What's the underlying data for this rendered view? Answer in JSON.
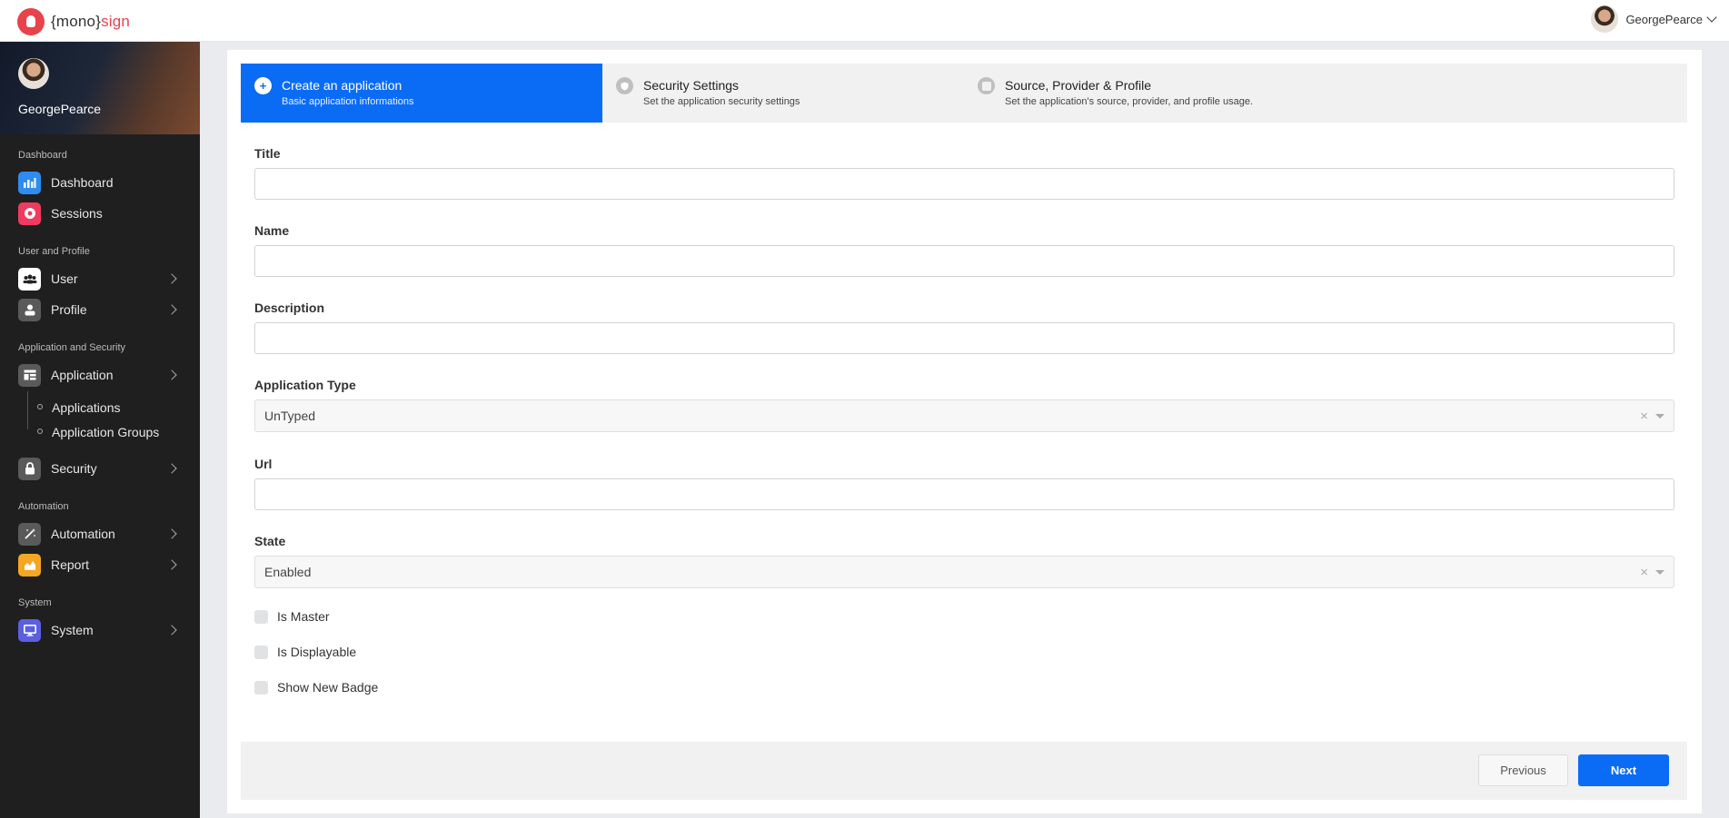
{
  "app": {
    "logo_prefix": "{mono}",
    "logo_suffix": "sign"
  },
  "user": {
    "name": "GeorgePearce"
  },
  "sidebar": {
    "sections": [
      {
        "label": "Dashboard"
      },
      {
        "label": "User and Profile"
      },
      {
        "label": "Application and Security"
      },
      {
        "label": "Automation"
      },
      {
        "label": "System"
      }
    ],
    "items": {
      "dashboard": {
        "label": "Dashboard",
        "icon": "chart-icon",
        "color": "#2e8cf0"
      },
      "sessions": {
        "label": "Sessions",
        "icon": "play-circle-icon",
        "color": "#f03a5f"
      },
      "user": {
        "label": "User",
        "icon": "users-icon",
        "color": "#ffffff"
      },
      "profile": {
        "label": "Profile",
        "icon": "person-icon",
        "color": "#5a5a5a"
      },
      "application": {
        "label": "Application",
        "icon": "app-window-icon",
        "color": "#5a5a5a"
      },
      "applications": {
        "label": "Applications"
      },
      "application_groups": {
        "label": "Application Groups"
      },
      "security": {
        "label": "Security",
        "icon": "lock-icon",
        "color": "#5a5a5a"
      },
      "automation": {
        "label": "Automation",
        "icon": "magic-wand-icon",
        "color": "#5a5a5a"
      },
      "report": {
        "label": "Report",
        "icon": "area-chart-icon",
        "color": "#f5a623"
      },
      "system": {
        "label": "System",
        "icon": "monitor-icon",
        "color": "#5b5fe0"
      }
    }
  },
  "wizard": {
    "steps": [
      {
        "title": "Create an application",
        "subtitle": "Basic application informations",
        "icon": "plus-icon",
        "active": true
      },
      {
        "title": "Security Settings",
        "subtitle": "Set the application security settings",
        "icon": "shield-icon",
        "active": false
      },
      {
        "title": "Source, Provider & Profile",
        "subtitle": "Set the application's source, provider, and profile usage.",
        "icon": "square-icon",
        "active": false
      }
    ]
  },
  "form": {
    "title_label": "Title",
    "title_value": "",
    "name_label": "Name",
    "name_value": "",
    "description_label": "Description",
    "description_value": "",
    "app_type_label": "Application Type",
    "app_type_value": "UnTyped",
    "url_label": "Url",
    "url_value": "",
    "state_label": "State",
    "state_value": "Enabled",
    "is_master_label": "Is Master",
    "is_master_checked": false,
    "is_displayable_label": "Is Displayable",
    "is_displayable_checked": false,
    "show_new_badge_label": "Show New Badge",
    "show_new_badge_checked": false
  },
  "footer": {
    "previous_label": "Previous",
    "next_label": "Next"
  },
  "colors": {
    "accent": "#0a6cf5",
    "brand": "#e8424a",
    "sidebar_bg": "#1f1f1f"
  }
}
